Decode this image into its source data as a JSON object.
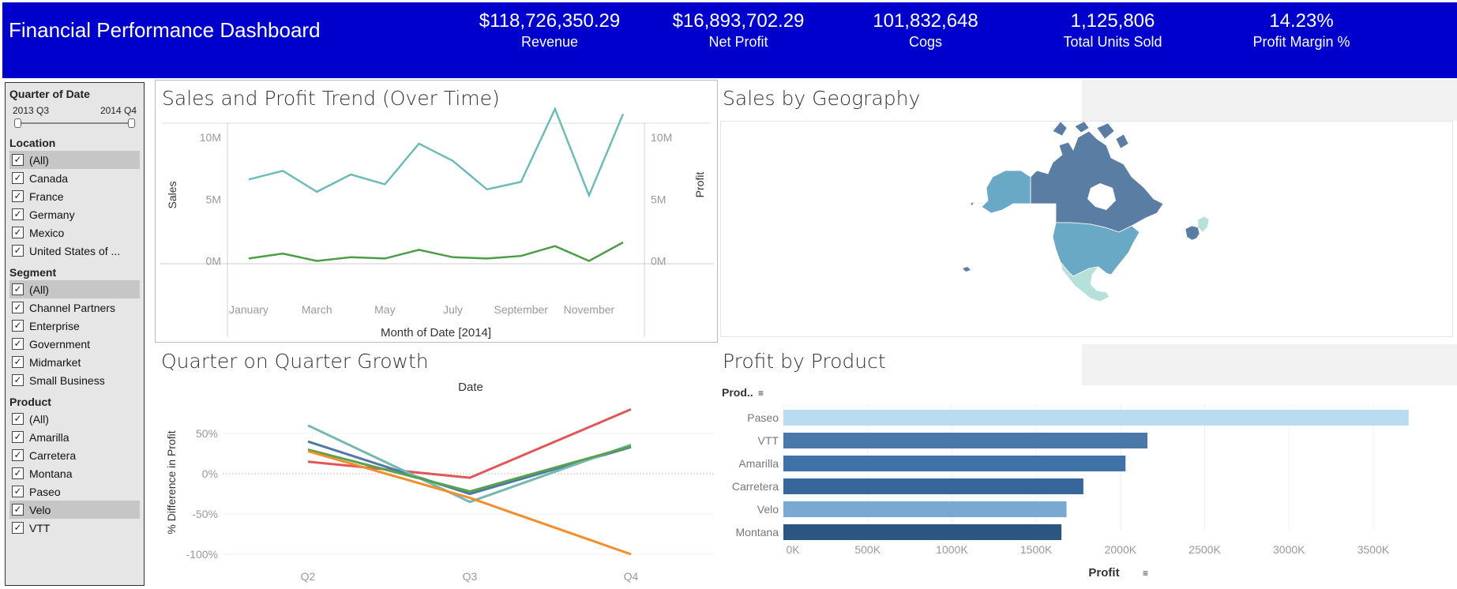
{
  "header": {
    "title": "Financial Performance Dashboard",
    "bg_color": "#0000cc",
    "kpis": [
      {
        "value": "$118,726,350.29",
        "label": "Revenue"
      },
      {
        "value": "$16,893,702.29",
        "label": "Net Profit"
      },
      {
        "value": "101,832,648",
        "label": "Cogs"
      },
      {
        "value": "1,125,806",
        "label": "Total Units Sold"
      },
      {
        "value": "14.23%",
        "label": "Profit Margin %"
      }
    ]
  },
  "filters": {
    "quarter": {
      "title": "Quarter of Date",
      "start": "2013 Q3",
      "end": "2014 Q4"
    },
    "location": {
      "title": "Location",
      "items": [
        {
          "label": "(All)",
          "checked": true,
          "selected": true
        },
        {
          "label": "Canada",
          "checked": true
        },
        {
          "label": "France",
          "checked": true
        },
        {
          "label": "Germany",
          "checked": true
        },
        {
          "label": "Mexico",
          "checked": true
        },
        {
          "label": "United States of ...",
          "checked": true
        }
      ]
    },
    "segment": {
      "title": "Segment",
      "items": [
        {
          "label": "(All)",
          "checked": true,
          "selected": true
        },
        {
          "label": "Channel Partners",
          "checked": true
        },
        {
          "label": "Enterprise",
          "checked": true
        },
        {
          "label": "Government",
          "checked": true
        },
        {
          "label": "Midmarket",
          "checked": true
        },
        {
          "label": "Small Business",
          "checked": true
        }
      ]
    },
    "product": {
      "title": "Product",
      "items": [
        {
          "label": "(All)",
          "checked": true
        },
        {
          "label": "Amarilla",
          "checked": true
        },
        {
          "label": "Carretera",
          "checked": true
        },
        {
          "label": "Montana",
          "checked": true
        },
        {
          "label": "Paseo",
          "checked": true
        },
        {
          "label": "Velo",
          "checked": true,
          "selected": true
        },
        {
          "label": "VTT",
          "checked": true
        }
      ]
    }
  },
  "panels": {
    "trend_title": "Sales and Profit Trend (Over Time)",
    "geo_title": "Sales by Geography",
    "qoq_title": "Quarter on Quarter Growth",
    "product_title": "Profit by Product"
  },
  "map_colors": {
    "dark": "#5a7ea3",
    "mid": "#6aa9c6",
    "light": "#b6e0da"
  },
  "chart_data": [
    {
      "type": "line",
      "title": "Sales and Profit Trend (Over Time)",
      "xlabel": "Month of Date [2014]",
      "ylabel": "Sales",
      "y2label": "Profit",
      "x": [
        "Jan",
        "Feb",
        "Mar",
        "Apr",
        "May",
        "Jun",
        "Jul",
        "Aug",
        "Sep",
        "Oct",
        "Nov",
        "Dec"
      ],
      "x_tick_labels": [
        "January",
        "March",
        "May",
        "July",
        "September",
        "November"
      ],
      "y_ticks": [
        "0M",
        "5M",
        "10M"
      ],
      "y2_ticks": [
        "0M",
        "5M",
        "10M"
      ],
      "ylim": [
        -0.8,
        12.5
      ],
      "series": [
        {
          "name": "Sales",
          "axis": "left",
          "color": "#6dbcba",
          "values": [
            6.6,
            7.3,
            5.6,
            7.0,
            6.2,
            9.5,
            8.1,
            5.8,
            6.4,
            12.3,
            5.3,
            11.9
          ]
        },
        {
          "name": "Profit",
          "axis": "right",
          "color": "#4b9e45",
          "values": [
            0.2,
            0.6,
            0.0,
            0.3,
            0.2,
            0.9,
            0.3,
            0.2,
            0.4,
            1.2,
            0.0,
            1.5
          ]
        }
      ]
    },
    {
      "type": "line",
      "title": "Quarter on Quarter Growth",
      "top_label": "Date",
      "ylabel": "% Difference in Profit",
      "categories": [
        "Q2",
        "Q3",
        "Q4"
      ],
      "y_ticks": [
        "50%",
        "0%",
        "-50%",
        "-100%"
      ],
      "ylim": [
        -100,
        80
      ],
      "series": [
        {
          "color": "#e15759",
          "values": [
            15,
            -5,
            80
          ]
        },
        {
          "color": "#4e79a7",
          "values": [
            40,
            -25,
            33
          ]
        },
        {
          "color": "#76b7b2",
          "values": [
            60,
            -35,
            36
          ]
        },
        {
          "color": "#59a14f",
          "values": [
            30,
            -22,
            34
          ]
        },
        {
          "color": "#f28e2b",
          "values": [
            28,
            -30,
            -100
          ]
        }
      ]
    },
    {
      "type": "bar",
      "orientation": "horizontal",
      "title": "Profit by Product",
      "ylabel": "Prod..",
      "xlabel": "Profit",
      "categories": [
        "Paseo",
        "VTT",
        "Amarilla",
        "Carretera",
        "Velo",
        "Montana"
      ],
      "values": [
        3710000,
        2160000,
        2030000,
        1780000,
        1680000,
        1650000
      ],
      "colors": [
        "#b9dcf0",
        "#4a79a9",
        "#3f72a7",
        "#36669a",
        "#79a8d1",
        "#2c5580"
      ],
      "x_ticks": [
        "0K",
        "500K",
        "1000K",
        "1500K",
        "2000K",
        "2500K",
        "3000K",
        "3500K"
      ],
      "xlim": [
        0,
        3800000
      ]
    }
  ]
}
